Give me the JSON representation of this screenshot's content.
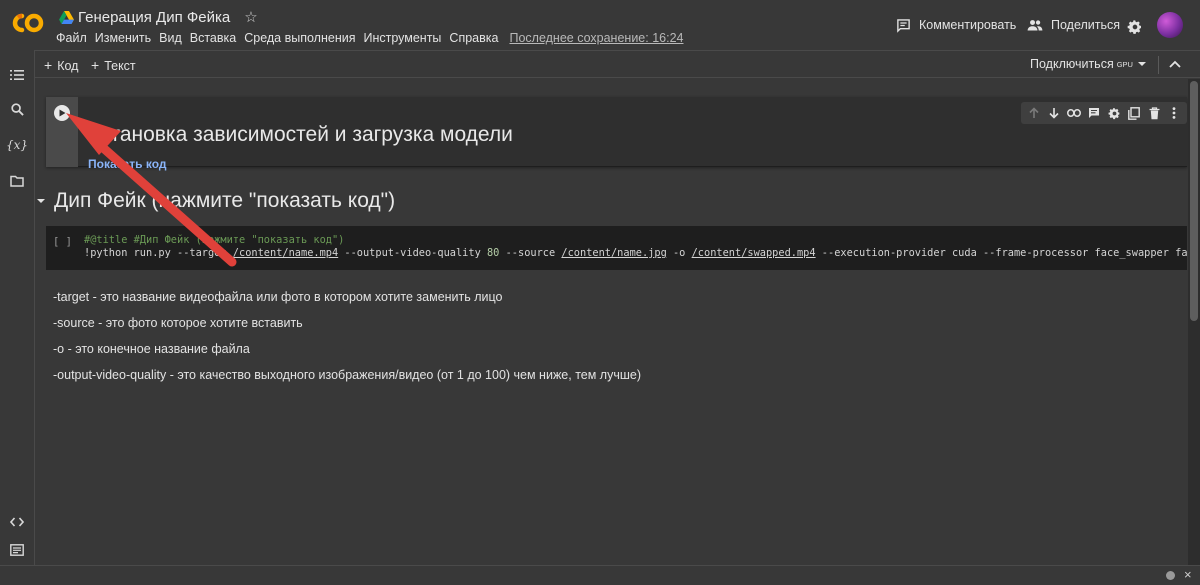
{
  "app": {
    "notebook_title": "Генерация Дип Фейка",
    "menu": [
      "Файл",
      "Изменить",
      "Вид",
      "Вставка",
      "Среда выполнения",
      "Инструменты",
      "Справка"
    ],
    "last_saved": "Последнее сохранение: 16:24",
    "comment_label": "Комментировать",
    "share_label": "Поделиться",
    "accent_color": "#f9ab00"
  },
  "toolbar": {
    "add_code_label": "Код",
    "add_text_label": "Текст",
    "connect_label": "Подключиться",
    "runtime_type": "GPU"
  },
  "cells": {
    "section1_title": "Установка зависимостей и загрузка модели",
    "section1_show_code": "Показать код",
    "section2_title": "Дип Фейк (нажмите \"показать код\")",
    "code_exec_count": "[ ]",
    "code_line1": "#@title #Дип Фейк (нажмите \"показать код\")",
    "code_line2_parts": [
      "!python run.py --target ",
      "/content/name.mp4",
      " --output-video-quality ",
      "80",
      " --source ",
      "/content/name.jpg",
      " -o ",
      "/content/swapped.mp4",
      " --execution-provider cuda --frame-processor face_swapper face_en"
    ],
    "paragraphs": [
      "-target - это название видеофайла или фото в котором хотите заменить лицо",
      "-source - это фото которое хотите вставить",
      "-o - это конечное название файла",
      "-output-video-quality - это качество выходного изображения/видео (от 1 до 100) чем ниже, тем лучше)"
    ]
  },
  "icons": {
    "sidebar": [
      "toc-icon",
      "search-icon",
      "variables-icon",
      "folder-icon",
      "code-snippets-icon",
      "terminal-icon"
    ],
    "cell_toolbar": [
      "arrow-up-icon",
      "arrow-down-icon",
      "link-icon",
      "comment-icon",
      "gear-icon",
      "mirror-cell-icon",
      "trash-icon",
      "more-vert-icon"
    ]
  },
  "annotation": {
    "arrow_color": "#e0413a"
  }
}
